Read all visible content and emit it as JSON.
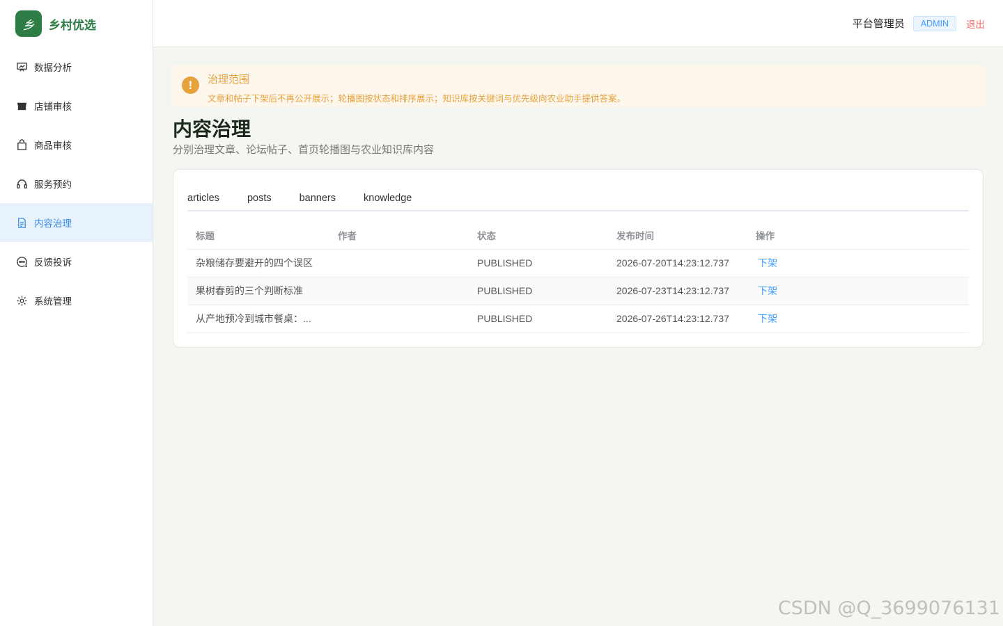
{
  "brand": {
    "logo_char": "乡",
    "name": "乡村优选"
  },
  "sidebar": {
    "items": [
      {
        "label": "数据分析",
        "icon": "chart-icon"
      },
      {
        "label": "店铺审核",
        "icon": "store-icon"
      },
      {
        "label": "商品审核",
        "icon": "bag-icon"
      },
      {
        "label": "服务预约",
        "icon": "headset-icon"
      },
      {
        "label": "内容治理",
        "icon": "document-icon",
        "active": true
      },
      {
        "label": "反馈投诉",
        "icon": "chat-icon"
      },
      {
        "label": "系统管理",
        "icon": "gear-icon"
      }
    ]
  },
  "header": {
    "user": "平台管理员",
    "role": "ADMIN",
    "logout": "退出"
  },
  "alert": {
    "title": "治理范围",
    "desc": "文章和帖子下架后不再公开展示；轮播图按状态和排序展示；知识库按关键词与优先级向农业助手提供答案。"
  },
  "page": {
    "title": "内容治理",
    "subtitle": "分别治理文章、论坛帖子、首页轮播图与农业知识库内容"
  },
  "tabs": [
    "articles",
    "posts",
    "banners",
    "knowledge"
  ],
  "table": {
    "headers": [
      "标题",
      "作者",
      "状态",
      "发布时间",
      "操作"
    ],
    "rows": [
      {
        "title": "杂粮储存要避开的四个误区",
        "author": "",
        "status": "PUBLISHED",
        "time": "2026-07-20T14:23:12.737",
        "action": "下架"
      },
      {
        "title": "果树春剪的三个判断标准",
        "author": "",
        "status": "PUBLISHED",
        "time": "2026-07-23T14:23:12.737",
        "action": "下架"
      },
      {
        "title": "从产地预冷到城市餐桌：...",
        "author": "",
        "status": "PUBLISHED",
        "time": "2026-07-26T14:23:12.737",
        "action": "下架"
      }
    ]
  },
  "watermark": "CSDN @Q_3699076131",
  "colors": {
    "brand": "#2e7d46",
    "active": "#3a8ee6",
    "warning": "#e6a23c",
    "danger": "#f56c6c"
  }
}
